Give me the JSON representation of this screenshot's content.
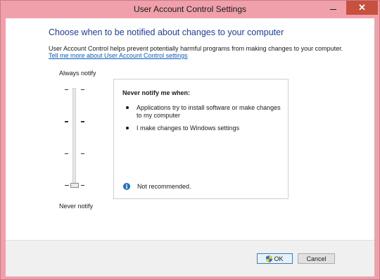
{
  "window": {
    "title": "User Account Control Settings",
    "close_glyph": "✕"
  },
  "main": {
    "heading": "Choose when to be notified about changes to your computer",
    "description": "User Account Control helps prevent potentially harmful programs from making changes to your computer.",
    "link": "Tell me more about User Account Control settings"
  },
  "slider": {
    "top_label": "Always notify",
    "bottom_label": "Never notify",
    "levels": 4,
    "selected_level": 1
  },
  "panel": {
    "title": "Never notify me when:",
    "bullets": [
      "Applications try to install software or make changes to my computer",
      "I make changes to Windows settings"
    ],
    "recommendation_icon": "info-icon",
    "recommendation": "Not recommended."
  },
  "footer": {
    "ok_label": "OK",
    "cancel_label": "Cancel",
    "ok_icon": "shield-icon"
  },
  "colors": {
    "titlebar": "#f0a0ab",
    "close_button": "#c7503f",
    "heading": "#1e3f9a",
    "link": "#0b5dbd",
    "info": "#1f6ec1"
  }
}
